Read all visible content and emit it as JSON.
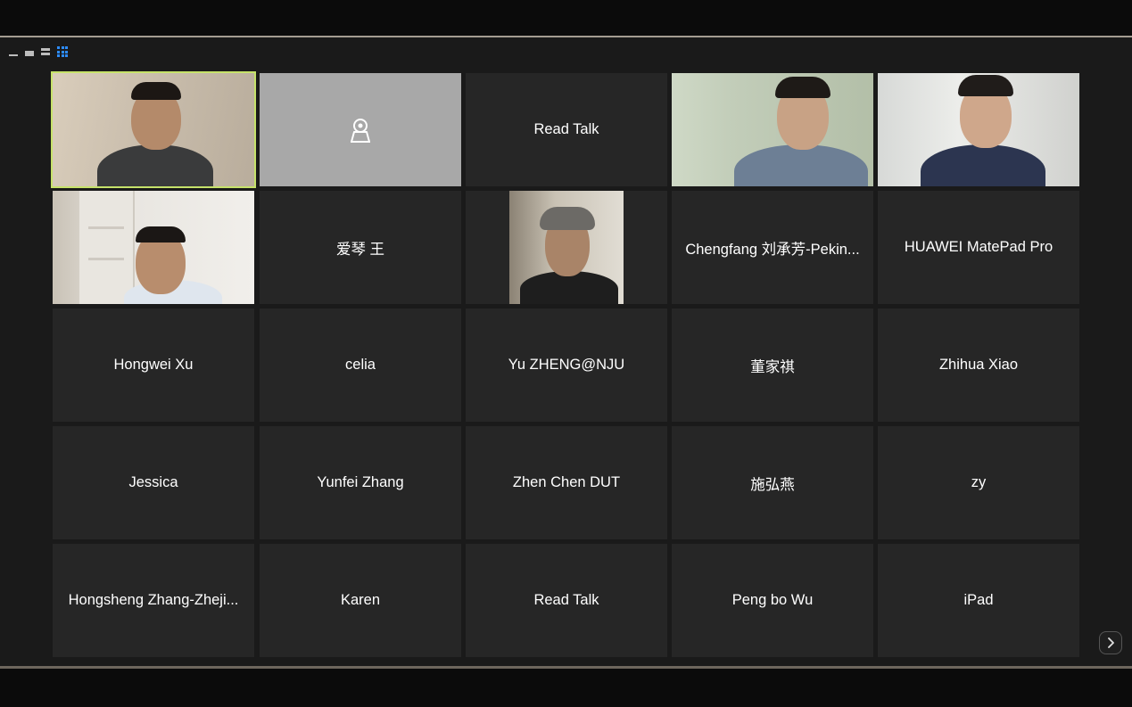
{
  "view_switcher": {
    "options": [
      "minimize",
      "speaker-view",
      "strip-view",
      "gallery-view"
    ],
    "selected": "gallery-view",
    "accent": "#2d8cff"
  },
  "tiles": [
    {
      "kind": "video",
      "active": true
    },
    {
      "kind": "no-video-icon",
      "icon": "camera-off-icon"
    },
    {
      "kind": "name",
      "name": "Read Talk"
    },
    {
      "kind": "video"
    },
    {
      "kind": "video"
    },
    {
      "kind": "video"
    },
    {
      "kind": "name",
      "name": "爱琴 王"
    },
    {
      "kind": "video"
    },
    {
      "kind": "name",
      "name": "Chengfang 刘承芳-Pekin..."
    },
    {
      "kind": "name",
      "name": "HUAWEI MatePad Pro"
    },
    {
      "kind": "name",
      "name": "Hongwei Xu"
    },
    {
      "kind": "name",
      "name": "celia"
    },
    {
      "kind": "name",
      "name": "Yu ZHENG@NJU"
    },
    {
      "kind": "name",
      "name": "董家祺"
    },
    {
      "kind": "name",
      "name": "Zhihua Xiao"
    },
    {
      "kind": "name",
      "name": "Jessica"
    },
    {
      "kind": "name",
      "name": "Yunfei Zhang"
    },
    {
      "kind": "name",
      "name": "Zhen Chen DUT"
    },
    {
      "kind": "name",
      "name": "施弘燕"
    },
    {
      "kind": "name",
      "name": "zy"
    },
    {
      "kind": "name",
      "name": "Hongsheng Zhang-Zheji..."
    },
    {
      "kind": "name",
      "name": "Karen"
    },
    {
      "kind": "name",
      "name": "Read Talk"
    },
    {
      "kind": "name",
      "name": "Peng bo Wu"
    },
    {
      "kind": "name",
      "name": "iPad"
    }
  ],
  "active_speaker_color": "#c6e26a",
  "next_page_icon": "chevron-right-icon"
}
